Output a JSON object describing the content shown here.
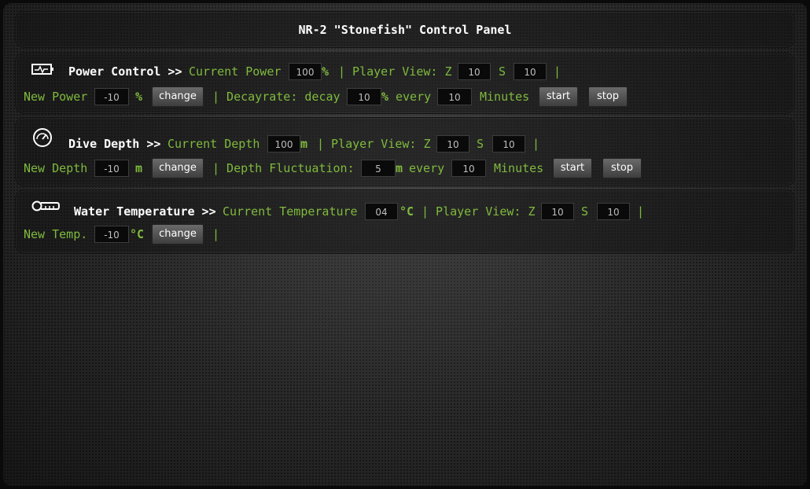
{
  "title": "NR-2 \"Stonefish\" Control Panel",
  "power": {
    "header": "Power Control >>",
    "current_label": "Current Power",
    "current_value": "100",
    "unit": "%",
    "player_view_label": "| Player View: Z",
    "z_value": "10",
    "s_label": "S",
    "s_value": "10",
    "pipe": "|",
    "new_label": "New Power",
    "new_value": "-10",
    "new_unit": "%",
    "change_label": "change",
    "decay_label": "| Decayrate: decay",
    "decay_value": "10",
    "decay_unit": "%",
    "every_label": "every",
    "every_value": "10",
    "minutes_label": "Minutes",
    "start_label": "start",
    "stop_label": "stop"
  },
  "depth": {
    "header": "Dive Depth >>",
    "current_label": "Current Depth",
    "current_value": "100",
    "unit": "m",
    "player_view_label": "| Player View: Z",
    "z_value": "10",
    "s_label": "S",
    "s_value": "10",
    "pipe": "|",
    "new_label": "New Depth",
    "new_value": "-10",
    "new_unit": "m",
    "change_label": "change",
    "fluct_label": "| Depth Fluctuation:",
    "fluct_value": "5",
    "fluct_unit": "m",
    "every_label": "every",
    "every_value": "10",
    "minutes_label": "Minutes",
    "start_label": "start",
    "stop_label": "stop"
  },
  "temp": {
    "header": "Water Temperature >>",
    "current_label": "Current Temperature",
    "current_value": "04",
    "unit": "°C",
    "player_view_label": "| Player View: Z",
    "z_value": "10",
    "s_label": "S",
    "s_value": "10",
    "pipe": "|",
    "new_label": "New Temp.",
    "new_value": "-10",
    "new_unit": "°C",
    "change_label": "change",
    "pipe2": "|"
  }
}
